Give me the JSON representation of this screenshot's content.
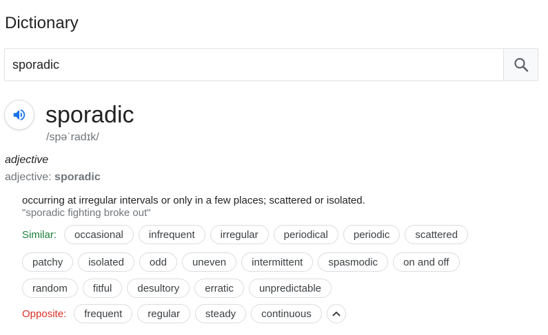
{
  "panel": {
    "title": "Dictionary"
  },
  "search": {
    "value": "sporadic",
    "button_icon": "search-icon"
  },
  "entry": {
    "speaker_icon": "speaker-icon",
    "word": "sporadic",
    "phonetic": "/spəˈradɪk/",
    "part_of_speech": "adjective",
    "form_prefix": "adjective: ",
    "form_word": "sporadic",
    "definition": "occurring at irregular intervals or only in a few places; scattered or isolated.",
    "example": "\"sporadic fighting broke out\""
  },
  "similar": {
    "label": "Similar:",
    "chips": [
      "occasional",
      "infrequent",
      "irregular",
      "periodical",
      "periodic",
      "scattered",
      "patchy",
      "isolated",
      "odd",
      "uneven",
      "intermittent",
      "spasmodic",
      "on and off",
      "random",
      "fitful",
      "desultory",
      "erratic",
      "unpredictable"
    ]
  },
  "opposite": {
    "label": "Opposite:",
    "chips": [
      "frequent",
      "regular",
      "steady",
      "continuous"
    ],
    "collapse_icon": "chevron-up-icon"
  },
  "colors": {
    "similar_label": "#188038",
    "opposite_label": "#d93025",
    "speaker_blue": "#1a73e8",
    "chip_border": "#dadce0"
  }
}
